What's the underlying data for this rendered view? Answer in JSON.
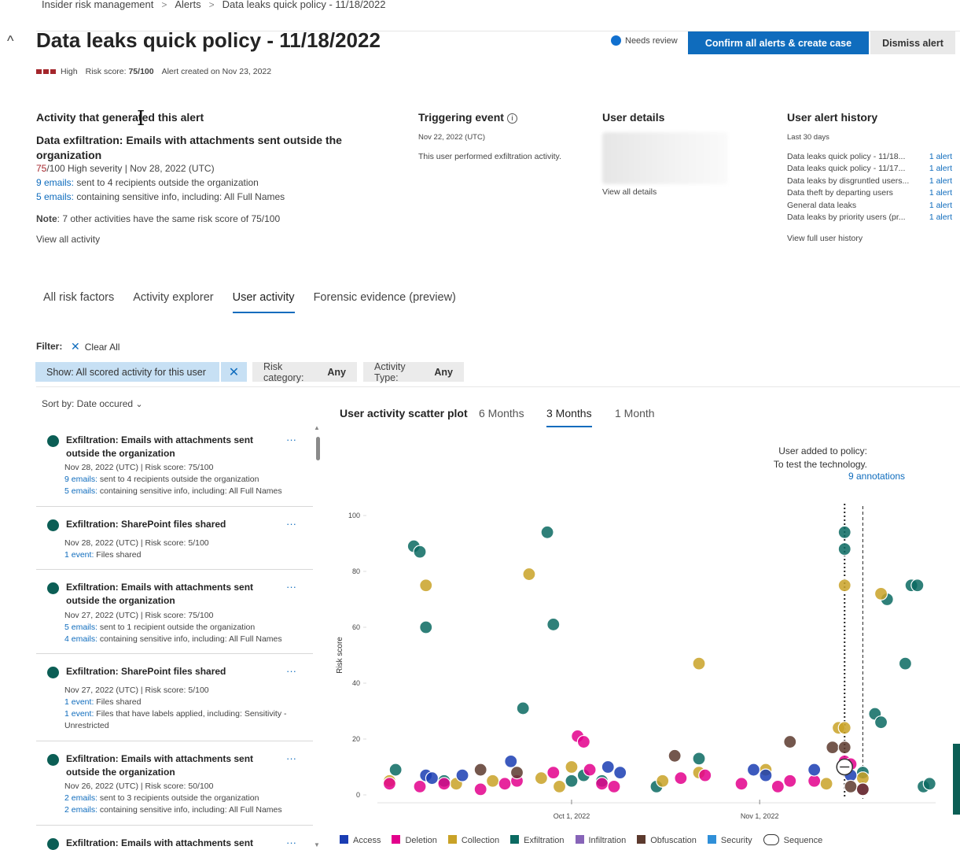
{
  "breadcrumb": [
    "Insider risk management",
    "Alerts",
    "Data leaks quick policy - 11/18/2022"
  ],
  "page_title": "Data leaks quick policy - 11/18/2022",
  "status": "Needs review",
  "buttons": {
    "confirm": "Confirm all alerts & create case",
    "dismiss": "Dismiss alert"
  },
  "meta": {
    "severity": "High",
    "risk_label": "Risk score:",
    "risk_value": "75/100",
    "created": "Alert created on Nov 23, 2022"
  },
  "activity": {
    "heading": "Activity that generated this alert",
    "title": "Data exfiltration: Emails with attachments sent outside the organization",
    "score": "75",
    "severity_line": "/100 High severity | Nov 28, 2022 (UTC)",
    "line1_link": "9 emails:",
    "line1_text": " sent to 4 recipients outside the organization",
    "line2_link": "5 emails:",
    "line2_text": " containing sensitive info, including: All Full Names",
    "note_label": "Note",
    "note_text": ": 7 other activities have the same risk score of 75/100",
    "view_all": "View all activity"
  },
  "triggering": {
    "heading": "Triggering event",
    "date": "Nov 22, 2022 (UTC)",
    "text": "This user performed exfiltration activity."
  },
  "user_details": {
    "heading": "User details",
    "link": "View all details"
  },
  "history": {
    "heading": "User alert history",
    "period": "Last 30 days",
    "rows": [
      {
        "name": "Data leaks quick policy - 11/18...",
        "count": "1 alert"
      },
      {
        "name": "Data leaks quick policy - 11/17...",
        "count": "1 alert"
      },
      {
        "name": "Data leaks by disgruntled users...",
        "count": "1 alert"
      },
      {
        "name": "Data theft by departing users",
        "count": "1 alert"
      },
      {
        "name": "General data leaks",
        "count": "1 alert"
      },
      {
        "name": "Data leaks by priority users (pr...",
        "count": "1 alert"
      }
    ],
    "link": "View full user history"
  },
  "tabs": [
    "All risk factors",
    "Activity explorer",
    "User activity",
    "Forensic evidence (preview)"
  ],
  "filter": {
    "label": "Filter:",
    "clear": "Clear All",
    "show": "Show: All scored activity for this user",
    "risk_label": "Risk category:",
    "risk_value": "Any",
    "type_label": "Activity Type:",
    "type_value": "Any"
  },
  "sort": "Sort by: Date occured",
  "cards": [
    {
      "title": "Exfiltration: Emails with attachments sent outside the organization",
      "meta": "Nov 28, 2022 (UTC) | Risk score: 75/100",
      "lines": [
        {
          "link": "9 emails:",
          "text": " sent to 4 recipients outside the organization"
        },
        {
          "link": "5 emails:",
          "text": " containing sensitive info, including: All Full Names"
        }
      ]
    },
    {
      "title": "Exfiltration: SharePoint files shared",
      "meta": "Nov 28, 2022 (UTC) | Risk score: 5/100",
      "lines": [
        {
          "link": "1 event:",
          "text": " Files shared"
        }
      ]
    },
    {
      "title": "Exfiltration: Emails with attachments sent outside the organization",
      "meta": "Nov 27, 2022 (UTC) | Risk score: 75/100",
      "lines": [
        {
          "link": "5 emails:",
          "text": " sent to 1 recipient outside the organization"
        },
        {
          "link": "4 emails:",
          "text": " containing sensitive info, including: All Full Names"
        }
      ]
    },
    {
      "title": "Exfiltration: SharePoint files shared",
      "meta": "Nov 27, 2022 (UTC) | Risk score: 5/100",
      "lines": [
        {
          "link": "1 event:",
          "text": " Files shared"
        },
        {
          "link": "1 event:",
          "text": " Files that have labels applied, including: Sensitivity -"
        },
        {
          "link": "",
          "text": "Unrestricted"
        }
      ]
    },
    {
      "title": "Exfiltration: Emails with attachments sent outside the organization",
      "meta": "Nov 26, 2022 (UTC) | Risk score: 50/100",
      "lines": [
        {
          "link": "2 emails:",
          "text": " sent to 3 recipients outside the organization"
        },
        {
          "link": "2 emails:",
          "text": " containing sensitive info, including: All Full Names"
        }
      ]
    },
    {
      "title": "Exfiltration: Emails with attachments sent",
      "meta": "",
      "lines": []
    }
  ],
  "plot": {
    "title": "User activity scatter plot",
    "ranges": [
      "6 Months",
      "3 Months",
      "1 Month"
    ],
    "annotation_text": "User added to policy: To test the technology.",
    "annotation_link": "9 annotations"
  },
  "legend": [
    {
      "name": "Access",
      "color": "#1a3db3"
    },
    {
      "name": "Deletion",
      "color": "#e3008c"
    },
    {
      "name": "Collection",
      "color": "#c9a227"
    },
    {
      "name": "Exfiltration",
      "color": "#0b6a62"
    },
    {
      "name": "Infiltration",
      "color": "#8764b8"
    },
    {
      "name": "Obfuscation",
      "color": "#5c3a2e"
    },
    {
      "name": "Security",
      "color": "#2f8fd8"
    },
    {
      "name": "Sequence",
      "color": "#333333"
    }
  ],
  "chart_data": {
    "type": "scatter",
    "title": "User activity scatter plot",
    "ylabel": "Risk score",
    "ylim": [
      0,
      100
    ],
    "yticks": [
      0,
      20,
      40,
      60,
      80,
      100
    ],
    "xticks": [
      "Oct 1, 2022",
      "Nov 1, 2022"
    ],
    "xlim": [
      "2022-08-30",
      "2022-11-30"
    ],
    "series": [
      {
        "name": "Exfiltration",
        "points": [
          [
            "2022-09-05",
            89
          ],
          [
            "2022-09-06",
            87
          ],
          [
            "2022-09-07",
            60
          ],
          [
            "2022-09-27",
            94
          ],
          [
            "2022-09-28",
            61
          ],
          [
            "2022-09-23",
            31
          ],
          [
            "2022-11-15",
            94
          ],
          [
            "2022-11-15",
            88
          ],
          [
            "2022-11-20",
            29
          ],
          [
            "2022-11-21",
            26
          ],
          [
            "2022-11-22",
            70
          ],
          [
            "2022-11-26",
            75
          ],
          [
            "2022-11-27",
            75
          ],
          [
            "2022-11-25",
            47
          ],
          [
            "2022-09-02",
            9
          ],
          [
            "2022-10-01",
            5
          ],
          [
            "2022-10-06",
            5
          ],
          [
            "2022-10-22",
            13
          ],
          [
            "2022-11-18",
            8
          ],
          [
            "2022-11-28",
            3
          ],
          [
            "2022-11-29",
            4
          ],
          [
            "2022-10-03",
            7
          ],
          [
            "2022-09-10",
            5
          ],
          [
            "2022-10-15",
            3
          ]
        ]
      },
      {
        "name": "Collection",
        "points": [
          [
            "2022-09-07",
            75
          ],
          [
            "2022-09-24",
            79
          ],
          [
            "2022-10-22",
            47
          ],
          [
            "2022-11-15",
            75
          ],
          [
            "2022-11-21",
            72
          ],
          [
            "2022-11-14",
            24
          ],
          [
            "2022-11-15",
            24
          ],
          [
            "2022-09-01",
            5
          ],
          [
            "2022-09-12",
            4
          ],
          [
            "2022-09-18",
            5
          ],
          [
            "2022-09-26",
            6
          ],
          [
            "2022-10-01",
            10
          ],
          [
            "2022-10-16",
            5
          ],
          [
            "2022-11-02",
            9
          ],
          [
            "2022-11-12",
            4
          ],
          [
            "2022-11-18",
            6
          ],
          [
            "2022-09-29",
            3
          ],
          [
            "2022-10-22",
            8
          ]
        ]
      },
      {
        "name": "Deletion",
        "points": [
          [
            "2022-10-02",
            21
          ],
          [
            "2022-10-03",
            19
          ],
          [
            "2022-09-01",
            4
          ],
          [
            "2022-09-06",
            3
          ],
          [
            "2022-09-10",
            4
          ],
          [
            "2022-09-16",
            2
          ],
          [
            "2022-09-20",
            4
          ],
          [
            "2022-09-22",
            5
          ],
          [
            "2022-09-28",
            8
          ],
          [
            "2022-10-04",
            9
          ],
          [
            "2022-10-06",
            4
          ],
          [
            "2022-10-08",
            3
          ],
          [
            "2022-10-19",
            6
          ],
          [
            "2022-10-23",
            7
          ],
          [
            "2022-10-29",
            4
          ],
          [
            "2022-11-04",
            3
          ],
          [
            "2022-11-06",
            5
          ],
          [
            "2022-11-10",
            5
          ],
          [
            "2022-11-15",
            12
          ],
          [
            "2022-11-16",
            11
          ],
          [
            "2022-11-18",
            2
          ]
        ]
      },
      {
        "name": "Access",
        "points": [
          [
            "2022-09-07",
            7
          ],
          [
            "2022-09-08",
            6
          ],
          [
            "2022-09-13",
            7
          ],
          [
            "2022-09-21",
            12
          ],
          [
            "2022-10-07",
            10
          ],
          [
            "2022-10-09",
            8
          ],
          [
            "2022-10-31",
            9
          ],
          [
            "2022-11-02",
            7
          ],
          [
            "2022-11-10",
            9
          ],
          [
            "2022-11-16",
            7
          ]
        ]
      },
      {
        "name": "Obfuscation",
        "points": [
          [
            "2022-10-18",
            14
          ],
          [
            "2022-11-06",
            19
          ],
          [
            "2022-11-13",
            17
          ],
          [
            "2022-11-15",
            17
          ],
          [
            "2022-11-16",
            3
          ],
          [
            "2022-11-18",
            2
          ],
          [
            "2022-09-22",
            8
          ],
          [
            "2022-09-16",
            9
          ]
        ]
      },
      {
        "name": "Sequence",
        "points": [
          [
            "2022-11-15",
            10
          ]
        ]
      }
    ],
    "annotations": [
      {
        "x": "2022-11-15",
        "label": "User added to policy: To test the technology.",
        "style": "dotted"
      },
      {
        "x": "2022-11-18",
        "label": "",
        "style": "dashed"
      }
    ],
    "grid": false,
    "legend_position": "bottom"
  }
}
